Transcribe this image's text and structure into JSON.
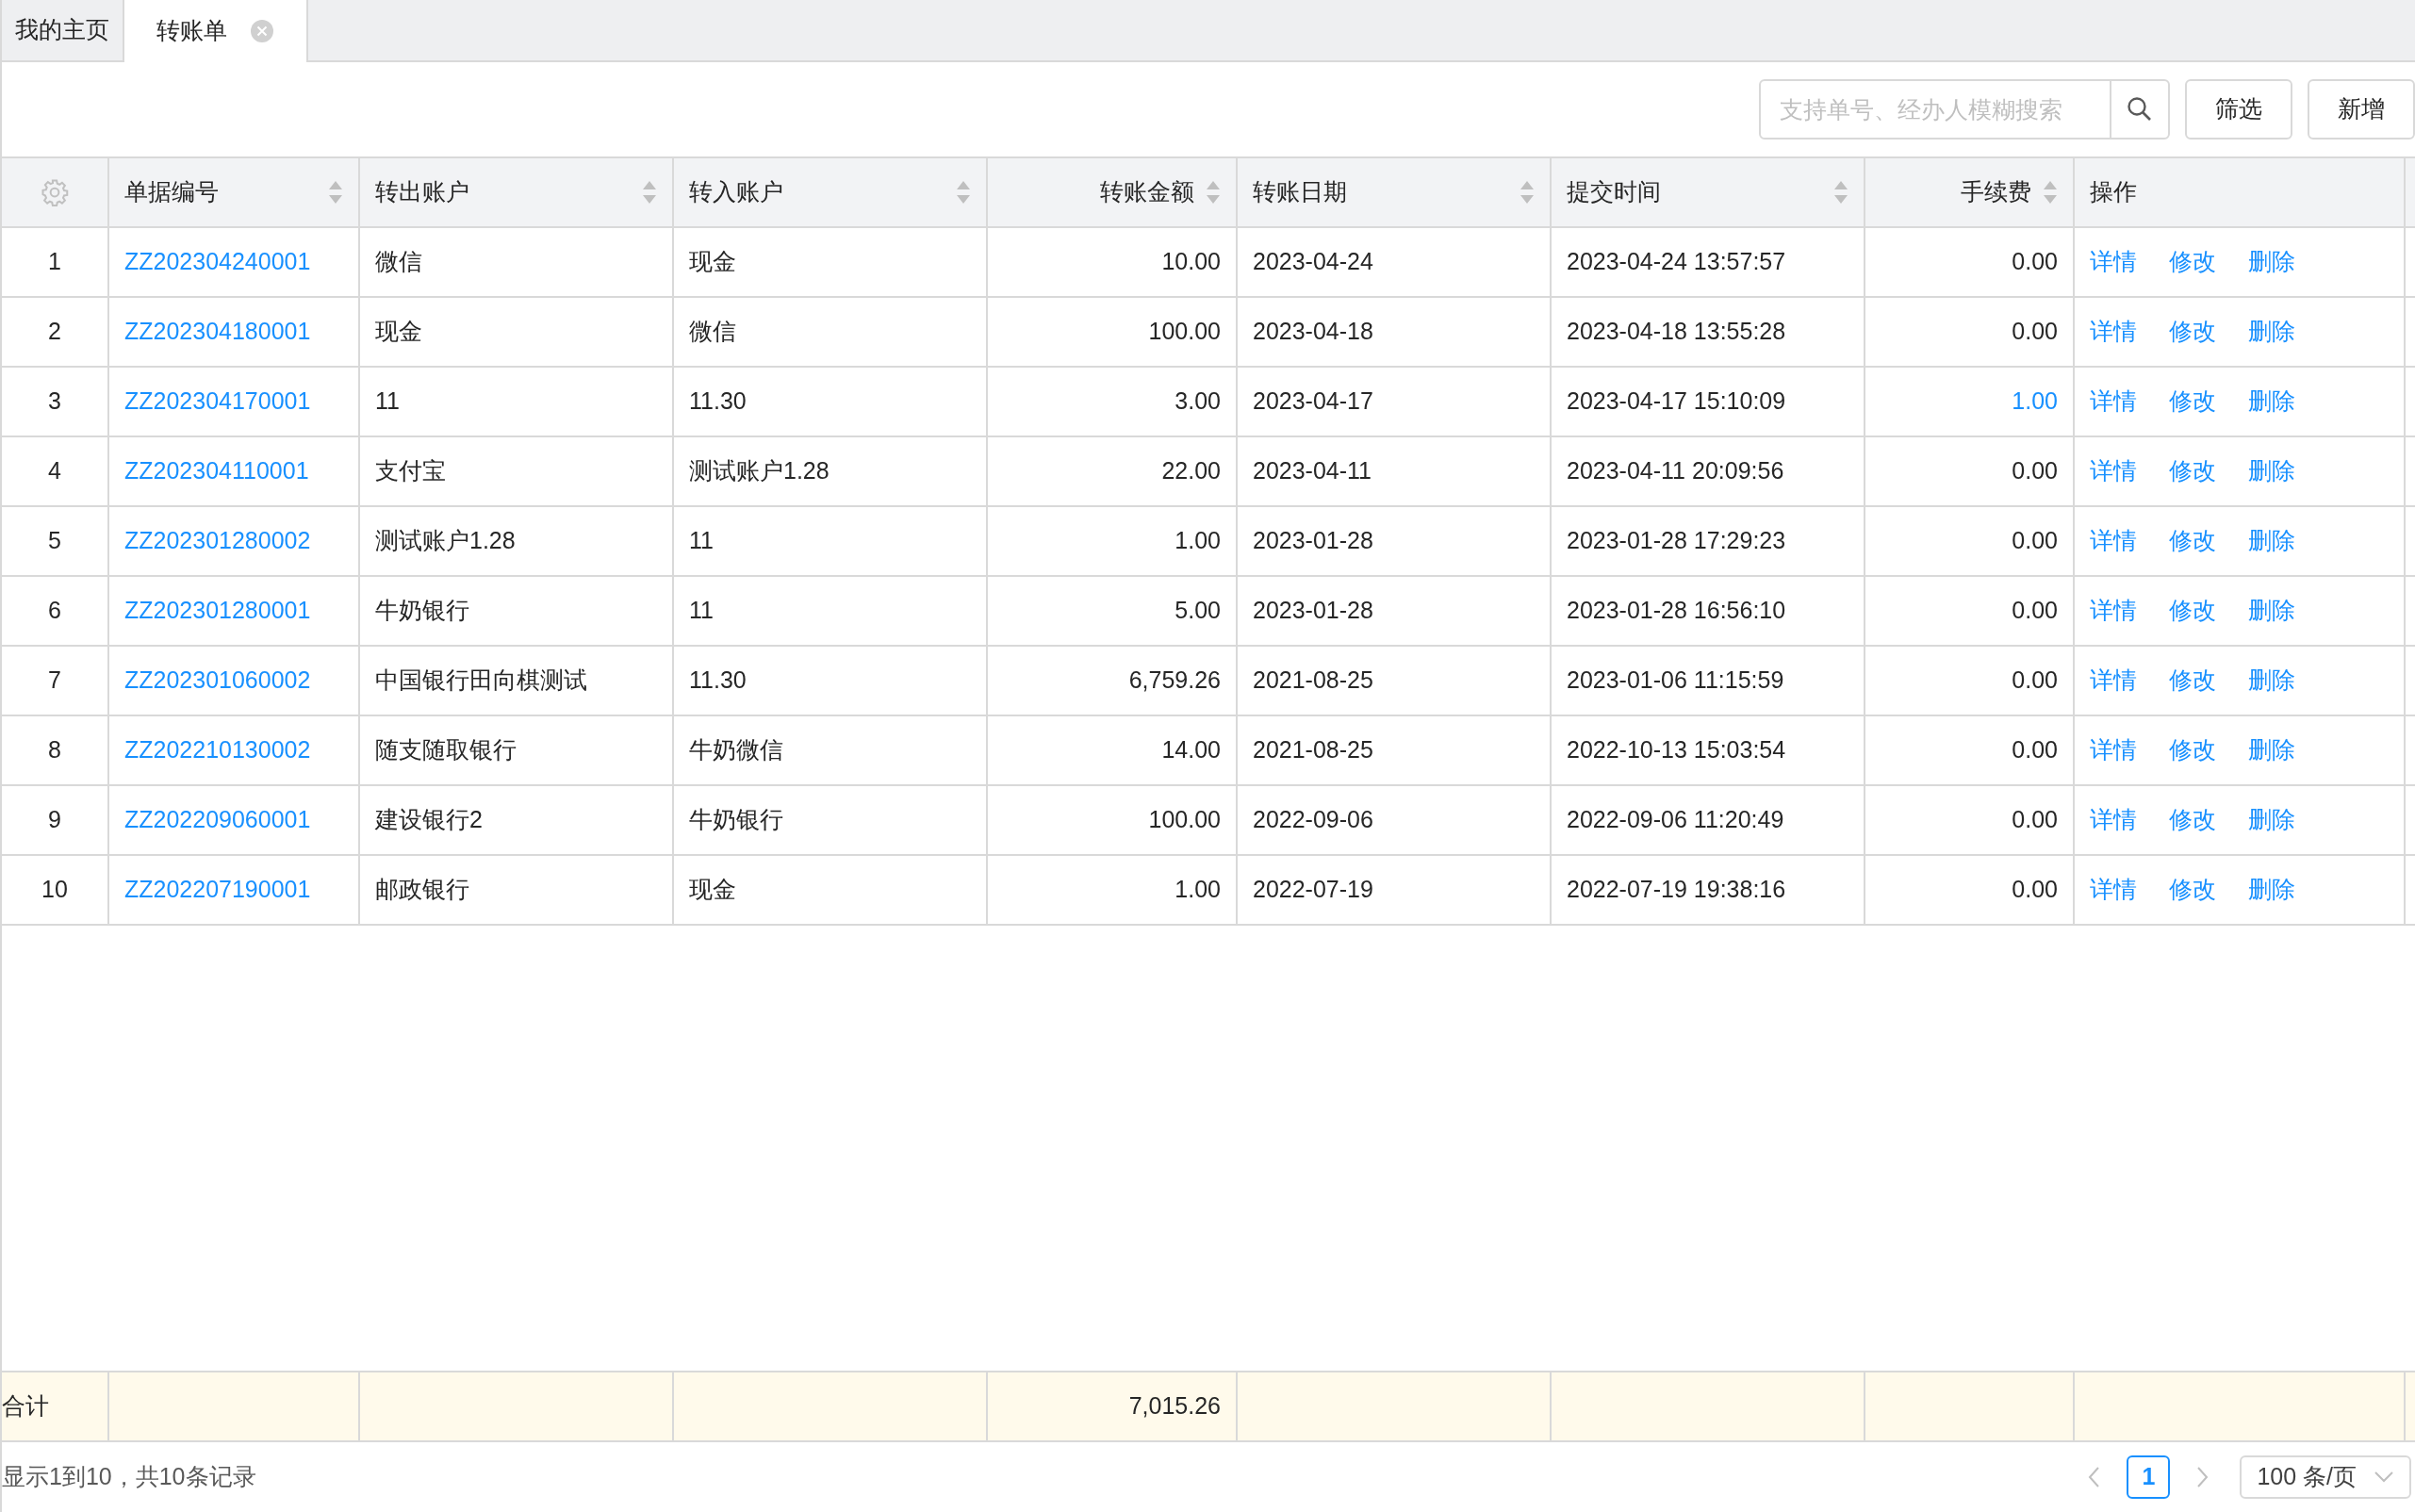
{
  "tabs": [
    {
      "label": "我的主页",
      "selected": false,
      "closable": false
    },
    {
      "label": "转账单",
      "selected": true,
      "closable": true
    }
  ],
  "toolbar": {
    "search": {
      "placeholder": "支持单号、经办人模糊搜索"
    },
    "buttons": [
      "筛选",
      "新增"
    ]
  },
  "table": {
    "columns": [
      {
        "label": "单据编号",
        "kind": "text",
        "sortable": true
      },
      {
        "label": "转出账户",
        "kind": "text",
        "sortable": true
      },
      {
        "label": "转入账户",
        "kind": "text",
        "sortable": true
      },
      {
        "label": "转账金额",
        "kind": "number",
        "sortable": true
      },
      {
        "label": "转账日期",
        "kind": "text",
        "sortable": true
      },
      {
        "label": "提交时间",
        "kind": "text",
        "sortable": true
      },
      {
        "label": "手续费",
        "kind": "number",
        "sortable": true
      },
      {
        "label": "操作",
        "kind": "text",
        "sortable": false
      }
    ],
    "rows": [
      {
        "index": "1",
        "number": "ZZ202304240001",
        "from": "微信",
        "to": "现金",
        "amount": "10.00",
        "date": "2023-04-24",
        "submitted": "2023-04-24 13:57:57",
        "fee": "0.00",
        "fee_highlighted": false,
        "actions": [
          "详情",
          "修改",
          "删除"
        ]
      },
      {
        "index": "2",
        "number": "ZZ202304180001",
        "from": "现金",
        "to": "微信",
        "amount": "100.00",
        "date": "2023-04-18",
        "submitted": "2023-04-18 13:55:28",
        "fee": "0.00",
        "fee_highlighted": false,
        "actions": [
          "详情",
          "修改",
          "删除"
        ]
      },
      {
        "index": "3",
        "number": "ZZ202304170001",
        "from": "11",
        "to": "11.30",
        "amount": "3.00",
        "date": "2023-04-17",
        "submitted": "2023-04-17 15:10:09",
        "fee": "1.00",
        "fee_highlighted": true,
        "actions": [
          "详情",
          "修改",
          "删除"
        ]
      },
      {
        "index": "4",
        "number": "ZZ202304110001",
        "from": "支付宝",
        "to": "测试账户1.28",
        "amount": "22.00",
        "date": "2023-04-11",
        "submitted": "2023-04-11 20:09:56",
        "fee": "0.00",
        "fee_highlighted": false,
        "actions": [
          "详情",
          "修改",
          "删除"
        ]
      },
      {
        "index": "5",
        "number": "ZZ202301280002",
        "from": "测试账户1.28",
        "to": "11",
        "amount": "1.00",
        "date": "2023-01-28",
        "submitted": "2023-01-28 17:29:23",
        "fee": "0.00",
        "fee_highlighted": false,
        "actions": [
          "详情",
          "修改",
          "删除"
        ]
      },
      {
        "index": "6",
        "number": "ZZ202301280001",
        "from": "牛奶银行",
        "to": "11",
        "amount": "5.00",
        "date": "2023-01-28",
        "submitted": "2023-01-28 16:56:10",
        "fee": "0.00",
        "fee_highlighted": false,
        "actions": [
          "详情",
          "修改",
          "删除"
        ]
      },
      {
        "index": "7",
        "number": "ZZ202301060002",
        "from": "中国银行田向棋测试",
        "to": "11.30",
        "amount": "6,759.26",
        "date": "2021-08-25",
        "submitted": "2023-01-06 11:15:59",
        "fee": "0.00",
        "fee_highlighted": false,
        "actions": [
          "详情",
          "修改",
          "删除"
        ]
      },
      {
        "index": "8",
        "number": "ZZ202210130002",
        "from": "随支随取银行",
        "to": "牛奶微信",
        "amount": "14.00",
        "date": "2021-08-25",
        "submitted": "2022-10-13 15:03:54",
        "fee": "0.00",
        "fee_highlighted": false,
        "actions": [
          "详情",
          "修改",
          "删除"
        ]
      },
      {
        "index": "9",
        "number": "ZZ202209060001",
        "from": "建设银行2",
        "to": "牛奶银行",
        "amount": "100.00",
        "date": "2022-09-06",
        "submitted": "2022-09-06 11:20:49",
        "fee": "0.00",
        "fee_highlighted": false,
        "actions": [
          "详情",
          "修改",
          "删除"
        ]
      },
      {
        "index": "10",
        "number": "ZZ202207190001",
        "from": "邮政银行",
        "to": "现金",
        "amount": "1.00",
        "date": "2022-07-19",
        "submitted": "2022-07-19 19:38:16",
        "fee": "0.00",
        "fee_highlighted": false,
        "actions": [
          "详情",
          "修改",
          "删除"
        ]
      }
    ],
    "summary": {
      "label": "合计",
      "amount": "7,015.26"
    }
  },
  "pagination": {
    "info": "显示1到10，共10条记录",
    "pages": [
      {
        "label": "1",
        "selected": true
      }
    ],
    "page_size": "100 条/页"
  }
}
